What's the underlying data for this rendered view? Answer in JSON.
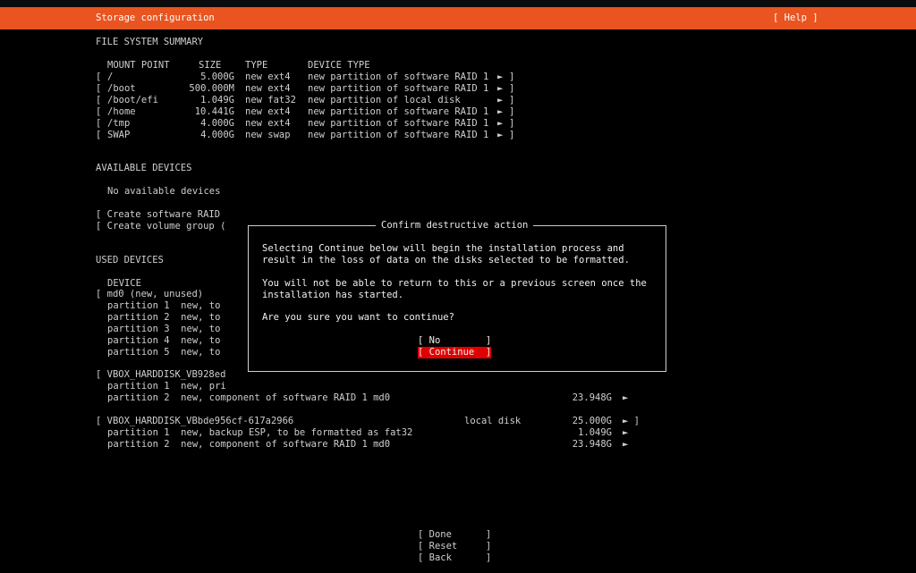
{
  "header": {
    "title": "Storage configuration",
    "help": "[ Help ]",
    "accent_color": "#e95420"
  },
  "fs_summary": {
    "heading": "FILE SYSTEM SUMMARY",
    "columns": {
      "mount": "MOUNT POINT",
      "size": "SIZE",
      "type": "TYPE",
      "device_type": "DEVICE TYPE"
    },
    "rows": [
      {
        "mount": "/",
        "size": "5.000G",
        "type": "new ext4",
        "device_type": "new partition of software RAID 1",
        "arrow": "►"
      },
      {
        "mount": "/boot",
        "size": "500.000M",
        "type": "new ext4",
        "device_type": "new partition of software RAID 1",
        "arrow": "►"
      },
      {
        "mount": "/boot/efi",
        "size": "1.049G",
        "type": "new fat32",
        "device_type": "new partition of local disk",
        "arrow": "►"
      },
      {
        "mount": "/home",
        "size": "10.441G",
        "type": "new ext4",
        "device_type": "new partition of software RAID 1",
        "arrow": "►"
      },
      {
        "mount": "/tmp",
        "size": "4.000G",
        "type": "new ext4",
        "device_type": "new partition of software RAID 1",
        "arrow": "►"
      },
      {
        "mount": "SWAP",
        "size": "4.000G",
        "type": "new swap",
        "device_type": "new partition of software RAID 1",
        "arrow": "►"
      }
    ]
  },
  "available": {
    "heading": "AVAILABLE DEVICES",
    "empty": "No available devices",
    "create_raid": "[ Create software RAID",
    "create_vg": "[ Create volume group ("
  },
  "used": {
    "heading": "USED DEVICES",
    "device_col": "DEVICE",
    "md0": "[ md0 (new, unused)",
    "md0_parts": [
      "partition 1  new, to",
      "partition 2  new, to",
      "partition 3  new, to",
      "partition 4  new, to",
      "partition 5  new, to"
    ],
    "disk1": {
      "name": "[ VBOX_HARDDISK_VB928ed",
      "partitions": [
        {
          "label": "partition 1  new, pri",
          "size": "",
          "arrow": ""
        },
        {
          "label": "partition 2  new, component of software RAID 1 md0",
          "size": "23.948G",
          "arrow": "►"
        }
      ]
    },
    "disk2": {
      "name": "[ VBOX_HARDDISK_VBbde956cf-617a2966",
      "kind": "local disk",
      "size": "25.000G",
      "arrow": "► ]",
      "partitions": [
        {
          "label": "partition 1  new, backup ESP, to be formatted as fat32",
          "size": "1.049G",
          "arrow": "►"
        },
        {
          "label": "partition 2  new, component of software RAID 1 md0",
          "size": "23.948G",
          "arrow": "►"
        }
      ]
    }
  },
  "dialog": {
    "title": "Confirm destructive action",
    "para1_line1": "Selecting Continue below will begin the installation process and",
    "para1_line2": "result in the loss of data on the disks selected to be formatted.",
    "para2_line1": "You will not be able to return to this or a previous screen once the",
    "para2_line2": "installation has started.",
    "question": "Are you sure you want to continue?",
    "no_label": "[ No        ]",
    "continue_label": "[ Continue  ]",
    "continue_color": "#e00000"
  },
  "footer": {
    "done": "[ Done      ]",
    "reset": "[ Reset     ]",
    "back": "[ Back      ]"
  }
}
